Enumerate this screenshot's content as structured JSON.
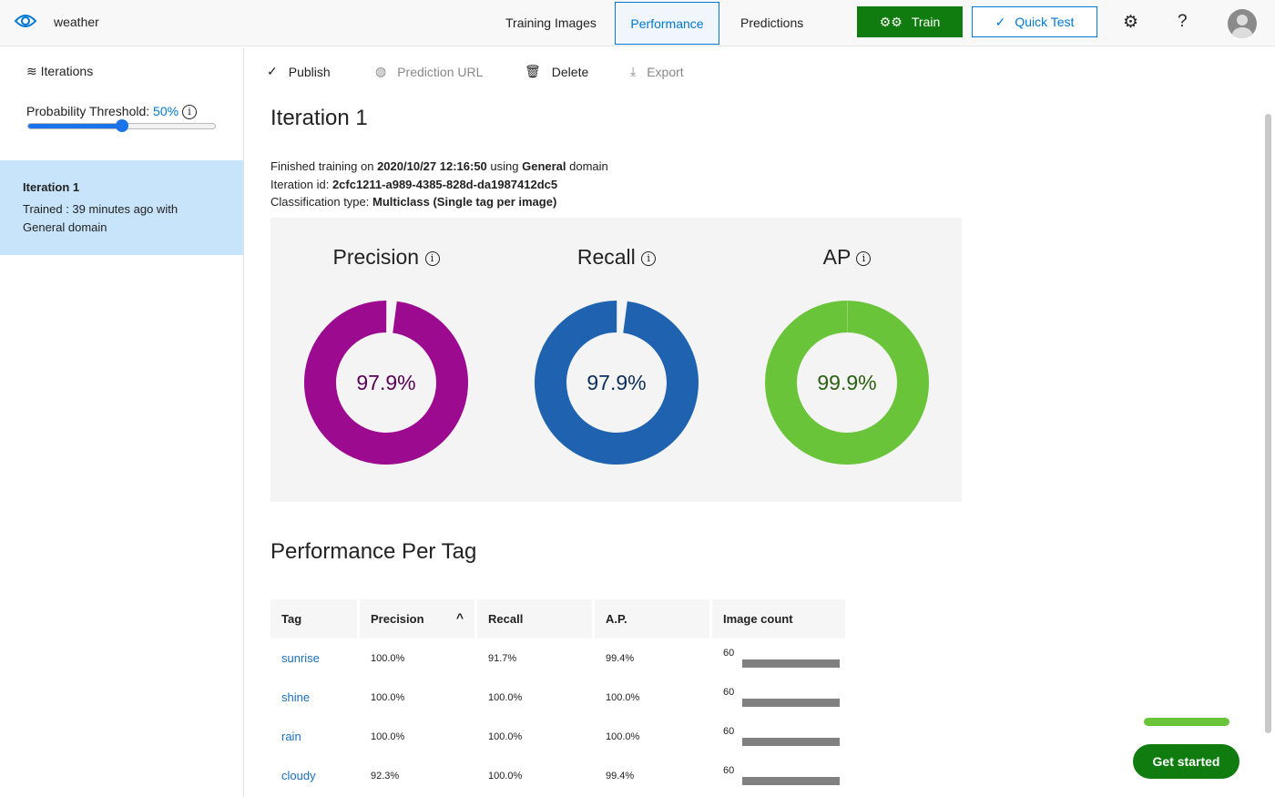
{
  "app": {
    "project": "weather"
  },
  "nav": {
    "tabs": [
      "Training Images",
      "Performance",
      "Predictions"
    ],
    "train": "Train",
    "quick_test": "Quick Test"
  },
  "sidebar": {
    "header": "Iterations",
    "threshold_label": "Probability Threshold:",
    "threshold_value": "50%",
    "threshold_fraction": 0.5,
    "item_title": "Iteration 1",
    "item_line1": "Trained : 39 minutes ago with",
    "item_line2": "General domain"
  },
  "toolbar": {
    "publish": "Publish",
    "prediction_url": "Prediction URL",
    "delete": "Delete",
    "export": "Export"
  },
  "main": {
    "title": "Iteration 1",
    "finished_prefix": "Finished training on ",
    "finished_date": "2020/10/27 12:16:50",
    "finished_mid": " using ",
    "domain": "General",
    "finished_suffix": " domain",
    "id_label": "Iteration id: ",
    "id": "2cfc1211-a989-4385-828d-da1987412dc5",
    "type_label": "Classification type: ",
    "type": "Multiclass (Single tag per image)"
  },
  "metrics": [
    {
      "label": "Precision",
      "value": "97.9%",
      "fraction": 0.979,
      "color": "#9b0a8f",
      "text_color": "#5a0054"
    },
    {
      "label": "Recall",
      "value": "97.9%",
      "fraction": 0.979,
      "color": "#1f63b0",
      "text_color": "#0c2e5a"
    },
    {
      "label": "AP",
      "value": "99.9%",
      "fraction": 0.999,
      "color": "#6ac43a",
      "text_color": "#2a6010"
    }
  ],
  "per_tag": {
    "title": "Performance Per Tag",
    "headers": [
      "Tag",
      "Precision",
      "Recall",
      "A.P.",
      "Image count"
    ],
    "rows": [
      {
        "tag": "sunrise",
        "precision": "100.0%",
        "recall": "91.7%",
        "ap": "99.4%",
        "count": "60"
      },
      {
        "tag": "shine",
        "precision": "100.0%",
        "recall": "100.0%",
        "ap": "100.0%",
        "count": "60"
      },
      {
        "tag": "rain",
        "precision": "100.0%",
        "recall": "100.0%",
        "ap": "100.0%",
        "count": "60"
      },
      {
        "tag": "cloudy",
        "precision": "92.3%",
        "recall": "100.0%",
        "ap": "99.4%",
        "count": "60"
      }
    ]
  },
  "get_started": "Get started"
}
